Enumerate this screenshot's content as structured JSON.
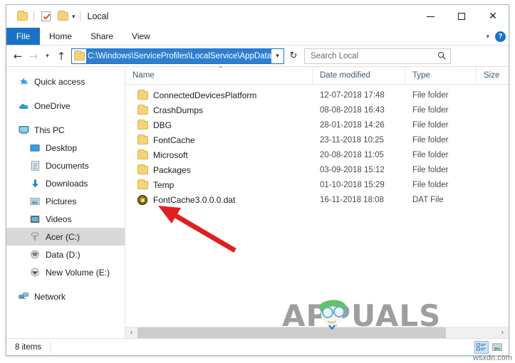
{
  "window": {
    "title": "Local",
    "quick_access_icons": [
      "folder-icon",
      "properties-checkbox-icon",
      "new-folder-icon",
      "customize-quick-access-caret-icon"
    ],
    "controls": {
      "minimize": "–",
      "maximize": "□",
      "close": "✕"
    }
  },
  "ribbon": {
    "tabs": [
      {
        "label": "File",
        "active": true
      },
      {
        "label": "Home",
        "active": false
      },
      {
        "label": "Share",
        "active": false
      },
      {
        "label": "View",
        "active": false
      }
    ],
    "collapse_caret": "⌄",
    "help_label": "?",
    "accent_color": "#1b72c4"
  },
  "address_bar": {
    "back": "←",
    "forward": "→",
    "recent_caret": "⌄",
    "up": "↑",
    "path": "C:\\Windows\\ServiceProfiles\\LocalService\\AppData\\Local",
    "path_selected": true,
    "dropdown_caret": "⌄",
    "refresh": "↻",
    "selection_color": "#2d7fd1"
  },
  "search": {
    "placeholder": "Search Local",
    "icon": "search-icon"
  },
  "sidebar": {
    "items": [
      {
        "label": "Quick access",
        "icon": "star-pin-icon",
        "indent": false,
        "selected": false,
        "gap": false
      },
      {
        "label": "OneDrive",
        "icon": "cloud-icon",
        "indent": false,
        "selected": false,
        "gap": true
      },
      {
        "label": "This PC",
        "icon": "monitor-icon",
        "indent": false,
        "selected": false,
        "gap": true
      },
      {
        "label": "Desktop",
        "icon": "desktop-icon",
        "indent": true,
        "selected": false,
        "gap": false
      },
      {
        "label": "Documents",
        "icon": "documents-icon",
        "indent": true,
        "selected": false,
        "gap": false
      },
      {
        "label": "Downloads",
        "icon": "download-arrow-icon",
        "indent": true,
        "selected": false,
        "gap": false
      },
      {
        "label": "Pictures",
        "icon": "pictures-icon",
        "indent": true,
        "selected": false,
        "gap": false
      },
      {
        "label": "Videos",
        "icon": "videos-film-icon",
        "indent": true,
        "selected": false,
        "gap": false
      },
      {
        "label": "Acer (C:)",
        "icon": "hard-drive-icon",
        "indent": true,
        "selected": true,
        "gap": false
      },
      {
        "label": "Data (D:)",
        "icon": "hard-drive-icon",
        "indent": true,
        "selected": false,
        "gap": false
      },
      {
        "label": "New Volume (E:)",
        "icon": "hard-drive-icon",
        "indent": true,
        "selected": false,
        "gap": false
      },
      {
        "label": "Network",
        "icon": "network-icon",
        "indent": false,
        "selected": false,
        "gap": true
      }
    ],
    "selected_bg": "#d8d8d8"
  },
  "file_list": {
    "columns": [
      {
        "key": "name",
        "label": "Name",
        "sorted": "asc",
        "sort_caret": "⌃"
      },
      {
        "key": "date",
        "label": "Date modified"
      },
      {
        "key": "type",
        "label": "Type"
      },
      {
        "key": "size",
        "label": "Size"
      }
    ],
    "rows": [
      {
        "name": "ConnectedDevicesPlatform",
        "date": "12-07-2018 17:48",
        "type": "File folder",
        "size": "",
        "icon": "folder-icon"
      },
      {
        "name": "CrashDumps",
        "date": "08-08-2018 16:43",
        "type": "File folder",
        "size": "",
        "icon": "folder-icon"
      },
      {
        "name": "DBG",
        "date": "28-01-2018 14:26",
        "type": "File folder",
        "size": "",
        "icon": "folder-icon"
      },
      {
        "name": "FontCache",
        "date": "23-11-2018 10:25",
        "type": "File folder",
        "size": "",
        "icon": "folder-icon"
      },
      {
        "name": "Microsoft",
        "date": "20-08-2018 11:05",
        "type": "File folder",
        "size": "",
        "icon": "folder-icon"
      },
      {
        "name": "Packages",
        "date": "03-09-2018 15:12",
        "type": "File folder",
        "size": "",
        "icon": "folder-icon"
      },
      {
        "name": "Temp",
        "date": "01-10-2018 15:29",
        "type": "File folder",
        "size": "",
        "icon": "folder-icon"
      },
      {
        "name": "FontCache3.0.0.0.dat",
        "date": "16-11-2018 18:08",
        "type": "DAT File",
        "size": "",
        "icon": "dat-file-icon"
      }
    ]
  },
  "scrollbar": {
    "left_arrow": "‹",
    "right_arrow": "›"
  },
  "status_bar": {
    "item_count": "8 items",
    "view_buttons": [
      {
        "name": "details-view",
        "active": true
      },
      {
        "name": "large-icons-view",
        "active": false
      }
    ]
  },
  "annotations": {
    "red_arrow": {
      "color": "#e02020",
      "points_to": "FontCache3.0.0.0.dat"
    }
  },
  "watermarks": {
    "brand": "APPUALS",
    "site": "wsxdn.com"
  }
}
